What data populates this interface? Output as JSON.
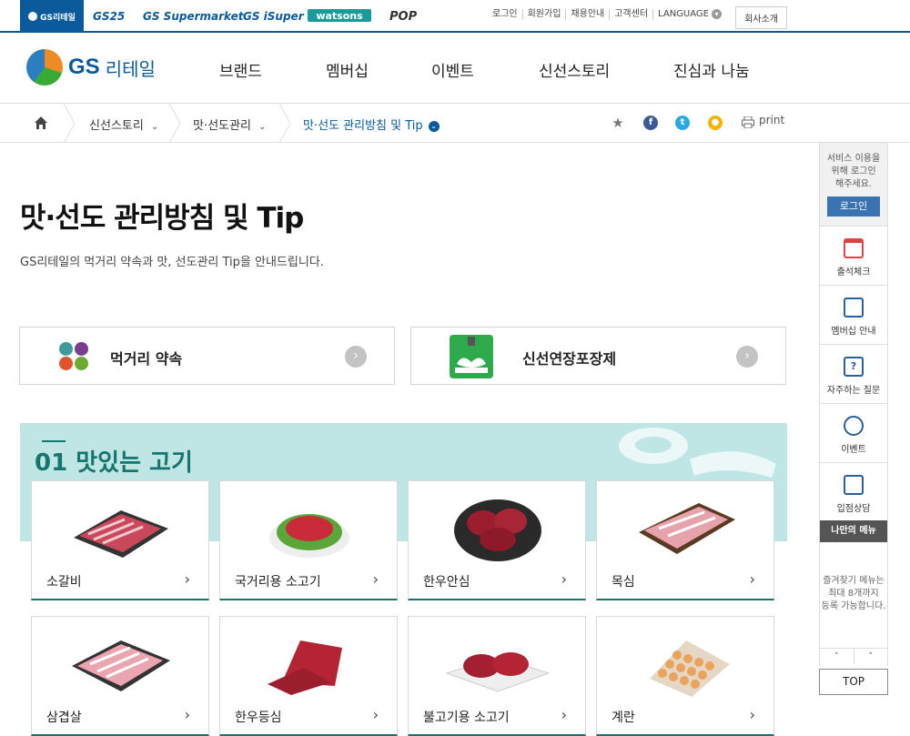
{
  "family_sites": {
    "gs_retail": "GS리테일",
    "gs25": "GS25",
    "supermarket": "GS Supermarket",
    "isuper": "GS iSuper",
    "watsons": "watsons",
    "pop": "POP"
  },
  "util_links": {
    "login": "로그인",
    "join": "회원가입",
    "recruit": "채용안내",
    "customer": "고객센터",
    "language": "LANGUAGE"
  },
  "company_intro": "회사소개",
  "logo": {
    "gs": "GS",
    "name": "리테일"
  },
  "gnb": [
    "브랜드",
    "멤버십",
    "이벤트",
    "신선스토리",
    "진심과 나눔"
  ],
  "breadcrumb": {
    "c1": "신선스토리",
    "c2": "맛·선도관리",
    "c3": "맛·선도 관리방침 및 Tip"
  },
  "print_label": "print",
  "page": {
    "title": "맛·선도 관리방침 및 Tip",
    "desc": "GS리테일의 먹거리 약속과 맛, 선도관리 Tip을 안내드립니다."
  },
  "cards": {
    "promise": "먹거리 약속",
    "fresh": "신선연장포장제"
  },
  "section": {
    "title": "01 맛있는 고기"
  },
  "items": [
    {
      "name": "소갈비"
    },
    {
      "name": "국거리용 소고기"
    },
    {
      "name": "한우안심"
    },
    {
      "name": "목심"
    },
    {
      "name": "삼겹살"
    },
    {
      "name": "한우등심"
    },
    {
      "name": "불고기용 소고기"
    },
    {
      "name": "계란"
    }
  ],
  "quick": {
    "login_line1": "서비스 이용을",
    "login_line2": "위해 로그인",
    "login_line3": "해주세요.",
    "login_btn": "로그인",
    "menu": [
      "출석체크",
      "멤버십 안내",
      "자주하는 질문",
      "이벤트",
      "입점상담"
    ],
    "my_menu": "나만의 메뉴",
    "note1": "즐겨찾기 메뉴는",
    "note2": "최대 8개까지",
    "note3": "등록 가능합니다.",
    "up": "˄",
    "down": "˅",
    "top": "TOP"
  },
  "colors": {
    "brand": "#0a5a9c",
    "accent_teal": "#16756e",
    "section_bg": "#bfe6e4"
  }
}
